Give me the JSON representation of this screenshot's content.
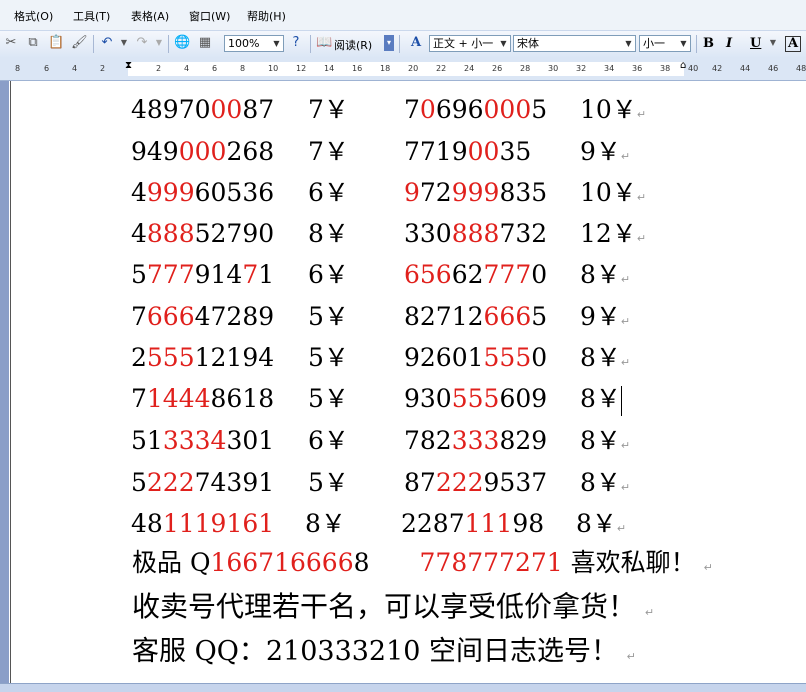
{
  "menu": [
    "格式(O)",
    "工具(T)",
    "表格(A)",
    "窗口(W)",
    "帮助(H)"
  ],
  "toolbar": {
    "zoom": "100%",
    "read_label": "阅读(R)",
    "style": "正文 + 小一",
    "font": "宋体",
    "size": "小一",
    "bold": "B",
    "italic": "I",
    "underline": "U",
    "char_border": "A"
  },
  "ruler_ticks": [
    "8",
    "6",
    "4",
    "2",
    "2",
    "4",
    "6",
    "8",
    "10",
    "12",
    "14",
    "16",
    "18",
    "20",
    "22",
    "24",
    "26",
    "28",
    "30",
    "32",
    "34",
    "36",
    "38",
    "40",
    "42",
    "44",
    "46",
    "48"
  ],
  "rows": [
    {
      "left": [
        [
          "48970",
          ""
        ],
        [
          "00",
          "r"
        ],
        [
          "87",
          ""
        ]
      ],
      "left_price": "7￥",
      "right": [
        [
          "7",
          ""
        ],
        [
          "0",
          "r"
        ],
        [
          "696",
          ""
        ],
        [
          "000",
          "r"
        ],
        [
          "5",
          ""
        ]
      ],
      "right_price": "10￥"
    },
    {
      "left": [
        [
          "949",
          ""
        ],
        [
          "000",
          "r"
        ],
        [
          "268",
          ""
        ]
      ],
      "left_price": "7￥",
      "right": [
        [
          "7719",
          ""
        ],
        [
          "00",
          "r"
        ],
        [
          "35",
          ""
        ]
      ],
      "right_price": "9￥"
    },
    {
      "left": [
        [
          "4",
          ""
        ],
        [
          "999",
          "r"
        ],
        [
          "60536",
          ""
        ]
      ],
      "left_price": "6￥",
      "right": [
        [
          "9",
          "r"
        ],
        [
          "72",
          ""
        ],
        [
          "999",
          "r"
        ],
        [
          "835",
          ""
        ]
      ],
      "right_price": "10￥"
    },
    {
      "left": [
        [
          "4",
          ""
        ],
        [
          "888",
          "r"
        ],
        [
          "52790",
          ""
        ]
      ],
      "left_price": "8￥",
      "right": [
        [
          "330",
          ""
        ],
        [
          "888",
          "r"
        ],
        [
          "732",
          ""
        ]
      ],
      "right_price": "12￥"
    },
    {
      "left": [
        [
          "5",
          ""
        ],
        [
          "777",
          "r"
        ],
        [
          "914",
          ""
        ],
        [
          "7",
          "r"
        ],
        [
          "1",
          ""
        ]
      ],
      "left_price": "6￥",
      "right": [
        [
          "656",
          "r"
        ],
        [
          "62",
          ""
        ],
        [
          "777",
          "r"
        ],
        [
          "0",
          ""
        ]
      ],
      "right_price": "8￥"
    },
    {
      "left": [
        [
          "7",
          ""
        ],
        [
          "666",
          "r"
        ],
        [
          "47289",
          ""
        ]
      ],
      "left_price": "5￥",
      "right": [
        [
          "82712",
          ""
        ],
        [
          "666",
          "r"
        ],
        [
          "5",
          ""
        ]
      ],
      "right_price": "9￥"
    },
    {
      "left": [
        [
          "2",
          ""
        ],
        [
          "555",
          "r"
        ],
        [
          "12194",
          ""
        ]
      ],
      "left_price": "5￥",
      "right": [
        [
          "92601",
          ""
        ],
        [
          "555",
          "r"
        ],
        [
          "0",
          ""
        ]
      ],
      "right_price": "8￥"
    },
    {
      "left": [
        [
          "7",
          ""
        ],
        [
          "1444",
          "r"
        ],
        [
          "8618",
          ""
        ]
      ],
      "left_price": "5￥",
      "right": [
        [
          "930",
          ""
        ],
        [
          "555",
          "r"
        ],
        [
          "609",
          ""
        ]
      ],
      "right_price": "8￥"
    },
    {
      "left": [
        [
          "51",
          ""
        ],
        [
          "3334",
          "r"
        ],
        [
          "301",
          ""
        ]
      ],
      "left_price": "6￥",
      "right": [
        [
          "782",
          ""
        ],
        [
          "333",
          "r"
        ],
        [
          "829",
          ""
        ]
      ],
      "right_price": "8￥"
    },
    {
      "left": [
        [
          "5",
          ""
        ],
        [
          "222",
          "r"
        ],
        [
          "74391",
          ""
        ]
      ],
      "left_price": "5￥",
      "right": [
        [
          "87",
          ""
        ],
        [
          "222",
          "r"
        ],
        [
          "9537",
          ""
        ]
      ],
      "right_price": "8￥"
    },
    {
      "left": [
        [
          "48",
          ""
        ],
        [
          "111",
          "r"
        ],
        [
          "9",
          "r"
        ],
        [
          "1",
          "r"
        ],
        [
          "6",
          "r"
        ],
        [
          "1",
          "r"
        ]
      ],
      "left_price": "8￥",
      "right": [
        [
          "2287",
          ""
        ],
        [
          "111",
          "r"
        ],
        [
          "98",
          ""
        ]
      ],
      "right_price": "8￥"
    }
  ],
  "line1": [
    [
      "极品 Q",
      ""
    ],
    [
      "166716666",
      "r"
    ],
    [
      "8",
      ""
    ],
    [
      "　　",
      ""
    ],
    [
      "778777271",
      "r"
    ],
    [
      "  喜欢私聊！",
      ""
    ]
  ],
  "line2": "收卖号代理若干名，可以享受低价拿货！",
  "line3": "客服 QQ：210333210 空间日志选号！"
}
